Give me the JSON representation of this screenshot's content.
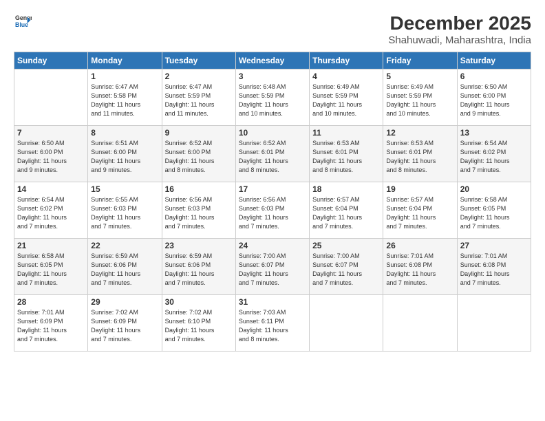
{
  "header": {
    "logo_line1": "General",
    "logo_line2": "Blue",
    "month": "December 2025",
    "location": "Shahuwadi, Maharashtra, India"
  },
  "weekdays": [
    "Sunday",
    "Monday",
    "Tuesday",
    "Wednesday",
    "Thursday",
    "Friday",
    "Saturday"
  ],
  "weeks": [
    [
      {
        "day": "",
        "info": ""
      },
      {
        "day": "1",
        "info": "Sunrise: 6:47 AM\nSunset: 5:58 PM\nDaylight: 11 hours\nand 11 minutes."
      },
      {
        "day": "2",
        "info": "Sunrise: 6:47 AM\nSunset: 5:59 PM\nDaylight: 11 hours\nand 11 minutes."
      },
      {
        "day": "3",
        "info": "Sunrise: 6:48 AM\nSunset: 5:59 PM\nDaylight: 11 hours\nand 10 minutes."
      },
      {
        "day": "4",
        "info": "Sunrise: 6:49 AM\nSunset: 5:59 PM\nDaylight: 11 hours\nand 10 minutes."
      },
      {
        "day": "5",
        "info": "Sunrise: 6:49 AM\nSunset: 5:59 PM\nDaylight: 11 hours\nand 10 minutes."
      },
      {
        "day": "6",
        "info": "Sunrise: 6:50 AM\nSunset: 6:00 PM\nDaylight: 11 hours\nand 9 minutes."
      }
    ],
    [
      {
        "day": "7",
        "info": "Sunrise: 6:50 AM\nSunset: 6:00 PM\nDaylight: 11 hours\nand 9 minutes."
      },
      {
        "day": "8",
        "info": "Sunrise: 6:51 AM\nSunset: 6:00 PM\nDaylight: 11 hours\nand 9 minutes."
      },
      {
        "day": "9",
        "info": "Sunrise: 6:52 AM\nSunset: 6:00 PM\nDaylight: 11 hours\nand 8 minutes."
      },
      {
        "day": "10",
        "info": "Sunrise: 6:52 AM\nSunset: 6:01 PM\nDaylight: 11 hours\nand 8 minutes."
      },
      {
        "day": "11",
        "info": "Sunrise: 6:53 AM\nSunset: 6:01 PM\nDaylight: 11 hours\nand 8 minutes."
      },
      {
        "day": "12",
        "info": "Sunrise: 6:53 AM\nSunset: 6:01 PM\nDaylight: 11 hours\nand 8 minutes."
      },
      {
        "day": "13",
        "info": "Sunrise: 6:54 AM\nSunset: 6:02 PM\nDaylight: 11 hours\nand 7 minutes."
      }
    ],
    [
      {
        "day": "14",
        "info": "Sunrise: 6:54 AM\nSunset: 6:02 PM\nDaylight: 11 hours\nand 7 minutes."
      },
      {
        "day": "15",
        "info": "Sunrise: 6:55 AM\nSunset: 6:03 PM\nDaylight: 11 hours\nand 7 minutes."
      },
      {
        "day": "16",
        "info": "Sunrise: 6:56 AM\nSunset: 6:03 PM\nDaylight: 11 hours\nand 7 minutes."
      },
      {
        "day": "17",
        "info": "Sunrise: 6:56 AM\nSunset: 6:03 PM\nDaylight: 11 hours\nand 7 minutes."
      },
      {
        "day": "18",
        "info": "Sunrise: 6:57 AM\nSunset: 6:04 PM\nDaylight: 11 hours\nand 7 minutes."
      },
      {
        "day": "19",
        "info": "Sunrise: 6:57 AM\nSunset: 6:04 PM\nDaylight: 11 hours\nand 7 minutes."
      },
      {
        "day": "20",
        "info": "Sunrise: 6:58 AM\nSunset: 6:05 PM\nDaylight: 11 hours\nand 7 minutes."
      }
    ],
    [
      {
        "day": "21",
        "info": "Sunrise: 6:58 AM\nSunset: 6:05 PM\nDaylight: 11 hours\nand 7 minutes."
      },
      {
        "day": "22",
        "info": "Sunrise: 6:59 AM\nSunset: 6:06 PM\nDaylight: 11 hours\nand 7 minutes."
      },
      {
        "day": "23",
        "info": "Sunrise: 6:59 AM\nSunset: 6:06 PM\nDaylight: 11 hours\nand 7 minutes."
      },
      {
        "day": "24",
        "info": "Sunrise: 7:00 AM\nSunset: 6:07 PM\nDaylight: 11 hours\nand 7 minutes."
      },
      {
        "day": "25",
        "info": "Sunrise: 7:00 AM\nSunset: 6:07 PM\nDaylight: 11 hours\nand 7 minutes."
      },
      {
        "day": "26",
        "info": "Sunrise: 7:01 AM\nSunset: 6:08 PM\nDaylight: 11 hours\nand 7 minutes."
      },
      {
        "day": "27",
        "info": "Sunrise: 7:01 AM\nSunset: 6:08 PM\nDaylight: 11 hours\nand 7 minutes."
      }
    ],
    [
      {
        "day": "28",
        "info": "Sunrise: 7:01 AM\nSunset: 6:09 PM\nDaylight: 11 hours\nand 7 minutes."
      },
      {
        "day": "29",
        "info": "Sunrise: 7:02 AM\nSunset: 6:09 PM\nDaylight: 11 hours\nand 7 minutes."
      },
      {
        "day": "30",
        "info": "Sunrise: 7:02 AM\nSunset: 6:10 PM\nDaylight: 11 hours\nand 7 minutes."
      },
      {
        "day": "31",
        "info": "Sunrise: 7:03 AM\nSunset: 6:11 PM\nDaylight: 11 hours\nand 8 minutes."
      },
      {
        "day": "",
        "info": ""
      },
      {
        "day": "",
        "info": ""
      },
      {
        "day": "",
        "info": ""
      }
    ]
  ]
}
